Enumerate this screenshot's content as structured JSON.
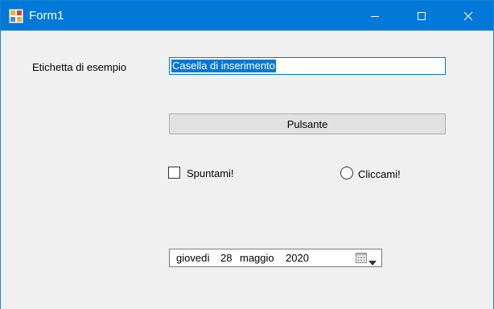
{
  "window": {
    "title": "Form1",
    "accent_color": "#0078d7",
    "client_bg": "#f0f0f0",
    "icons": [
      "app-icon",
      "minimize-icon",
      "maximize-icon",
      "close-icon"
    ]
  },
  "form": {
    "label": "Etichetta di esempio",
    "textbox_value": "Casella di inserimento",
    "button_label": "Pulsante",
    "checkbox_label": "Spuntami!",
    "checkbox_checked": false,
    "radio_label": "Cliccami!",
    "radio_checked": false,
    "date": {
      "weekday": "giovedì",
      "day": "28",
      "month": "maggio",
      "year": "2020",
      "icons": [
        "calendar-icon",
        "dropdown-arrow-icon"
      ]
    }
  }
}
